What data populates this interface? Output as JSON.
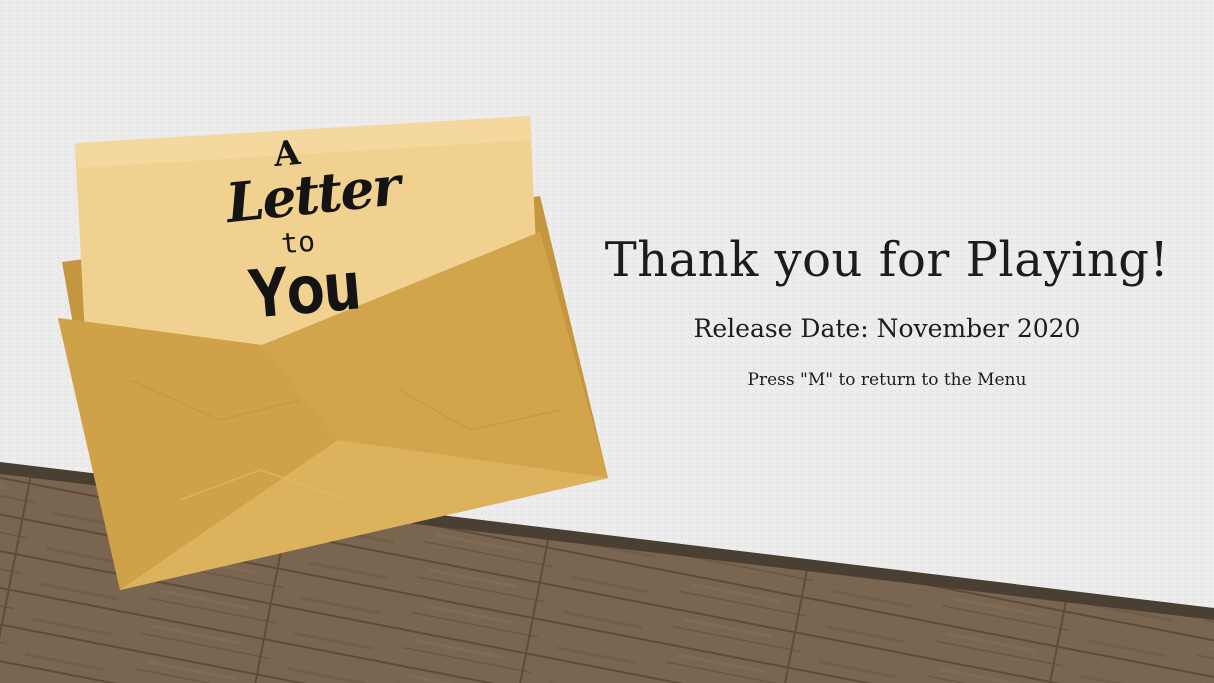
{
  "logo": {
    "line1": "A",
    "line2": "Letter",
    "line3": "to",
    "line4": "You"
  },
  "end_screen": {
    "headline": "Thank you for Playing!",
    "release_date": "Release Date: November 2020",
    "menu_hint": "Press \"M\" to return to the Menu"
  },
  "colors": {
    "wall": "#ececec",
    "wall_shadow": "#d6d6d6",
    "floor": "#7a6550",
    "floor_dark": "#5e4b3a",
    "baseboard": "#4a3f33",
    "envelope": "#d7ab52",
    "envelope_dark": "#c4963d",
    "paper": "#f0d18f",
    "text": "#1c1c1c"
  }
}
